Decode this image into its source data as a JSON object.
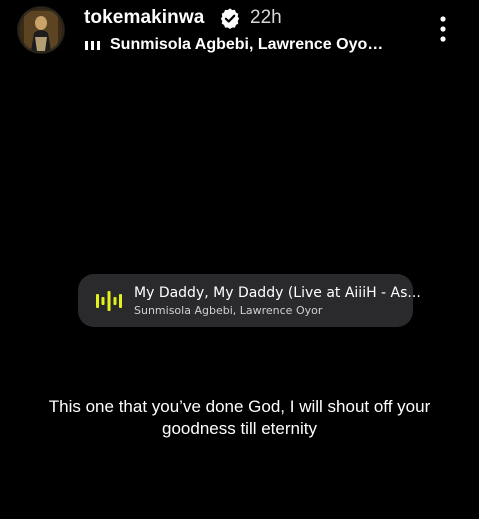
{
  "header": {
    "username": "tokemakinwa",
    "time_ago": "22h",
    "music_artists": "Sunmisola Agbebi, Lawrence Oyo…",
    "icons": {
      "avatar": "profile-avatar",
      "verified": "verified-badge-icon",
      "music": "audio-bars-icon",
      "more": "more-vertical-icon"
    }
  },
  "music_sticker": {
    "title": "My Daddy, My Daddy (Live at AiiiH - As...",
    "artists": "Sunmisola Agbebi, Lawrence Oyor",
    "icon": "audio-wave-icon",
    "accent_color": "#e3f31a"
  },
  "caption": {
    "line1": "This one that you’ve done God, I will shout off your",
    "line2": "goodness till eternity"
  },
  "colors": {
    "background": "#000000",
    "sticker_background": "#2a2a2d",
    "text": "#ffffff"
  }
}
